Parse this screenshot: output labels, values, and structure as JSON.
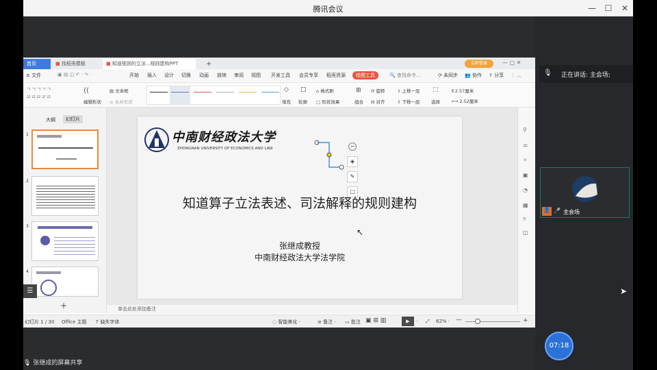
{
  "window": {
    "title": "腾讯会议"
  },
  "meeting": {
    "speaking": "正在讲话: 主会场;",
    "tile_name": "主会场",
    "timer": "07:18",
    "share_label": "张继成的屏幕共享"
  },
  "wps": {
    "tabs": [
      "首页",
      "找稻壳模板",
      "知道规则的立法...规则建构PPT"
    ],
    "menu": [
      "开始",
      "插入",
      "设计",
      "切换",
      "动画",
      "放映",
      "审阅",
      "视图",
      "开发工具",
      "会员专享",
      "稻壳资源",
      "绘图工具",
      "查找命令...",
      "未同步",
      "协作",
      "分享"
    ],
    "vip_label": "立即登录",
    "ribbon": {
      "text_box": "文本框",
      "edit_shape": "编辑形状",
      "merge_shape": "合并形状",
      "fill": "填充",
      "outline": "轮廓",
      "shape_effect": "形状效果",
      "format_brush": "格式刷",
      "group": "组合",
      "align": "对齐",
      "rotate": "旋转",
      "up_layer": "上移一层",
      "down_layer": "下移一层",
      "select": "选择",
      "height": "2.57厘米",
      "width": "2.52厘米",
      "file_menu": "文件"
    },
    "pane_tabs": [
      "大纲",
      "幻灯片"
    ],
    "thumb_numbers": [
      "1",
      "2",
      "3",
      "4"
    ],
    "slide": {
      "logo_cn": "中南财经政法大学",
      "logo_en": "ZHONGNAN UNIVERSITY OF ECONOMICS AND LAW",
      "title": "知道算子立法表述、司法解释的规则建构",
      "author": "张继成教授",
      "affiliation": "中南财经政法大学法学院"
    },
    "notes": "单击此处添加备注",
    "status": {
      "slide_info": "幻灯片 1 / 30",
      "theme": "Office 主题",
      "font": "缺失字体",
      "beautify": "智能美化",
      "notes_btn": "备注",
      "comment": "批注",
      "zoom": "62%"
    }
  },
  "colors": {
    "accent": "#e9553d",
    "tab_active": "#ffffff",
    "tile_border": "#1c7a5a",
    "timer": "#2b72d8"
  }
}
